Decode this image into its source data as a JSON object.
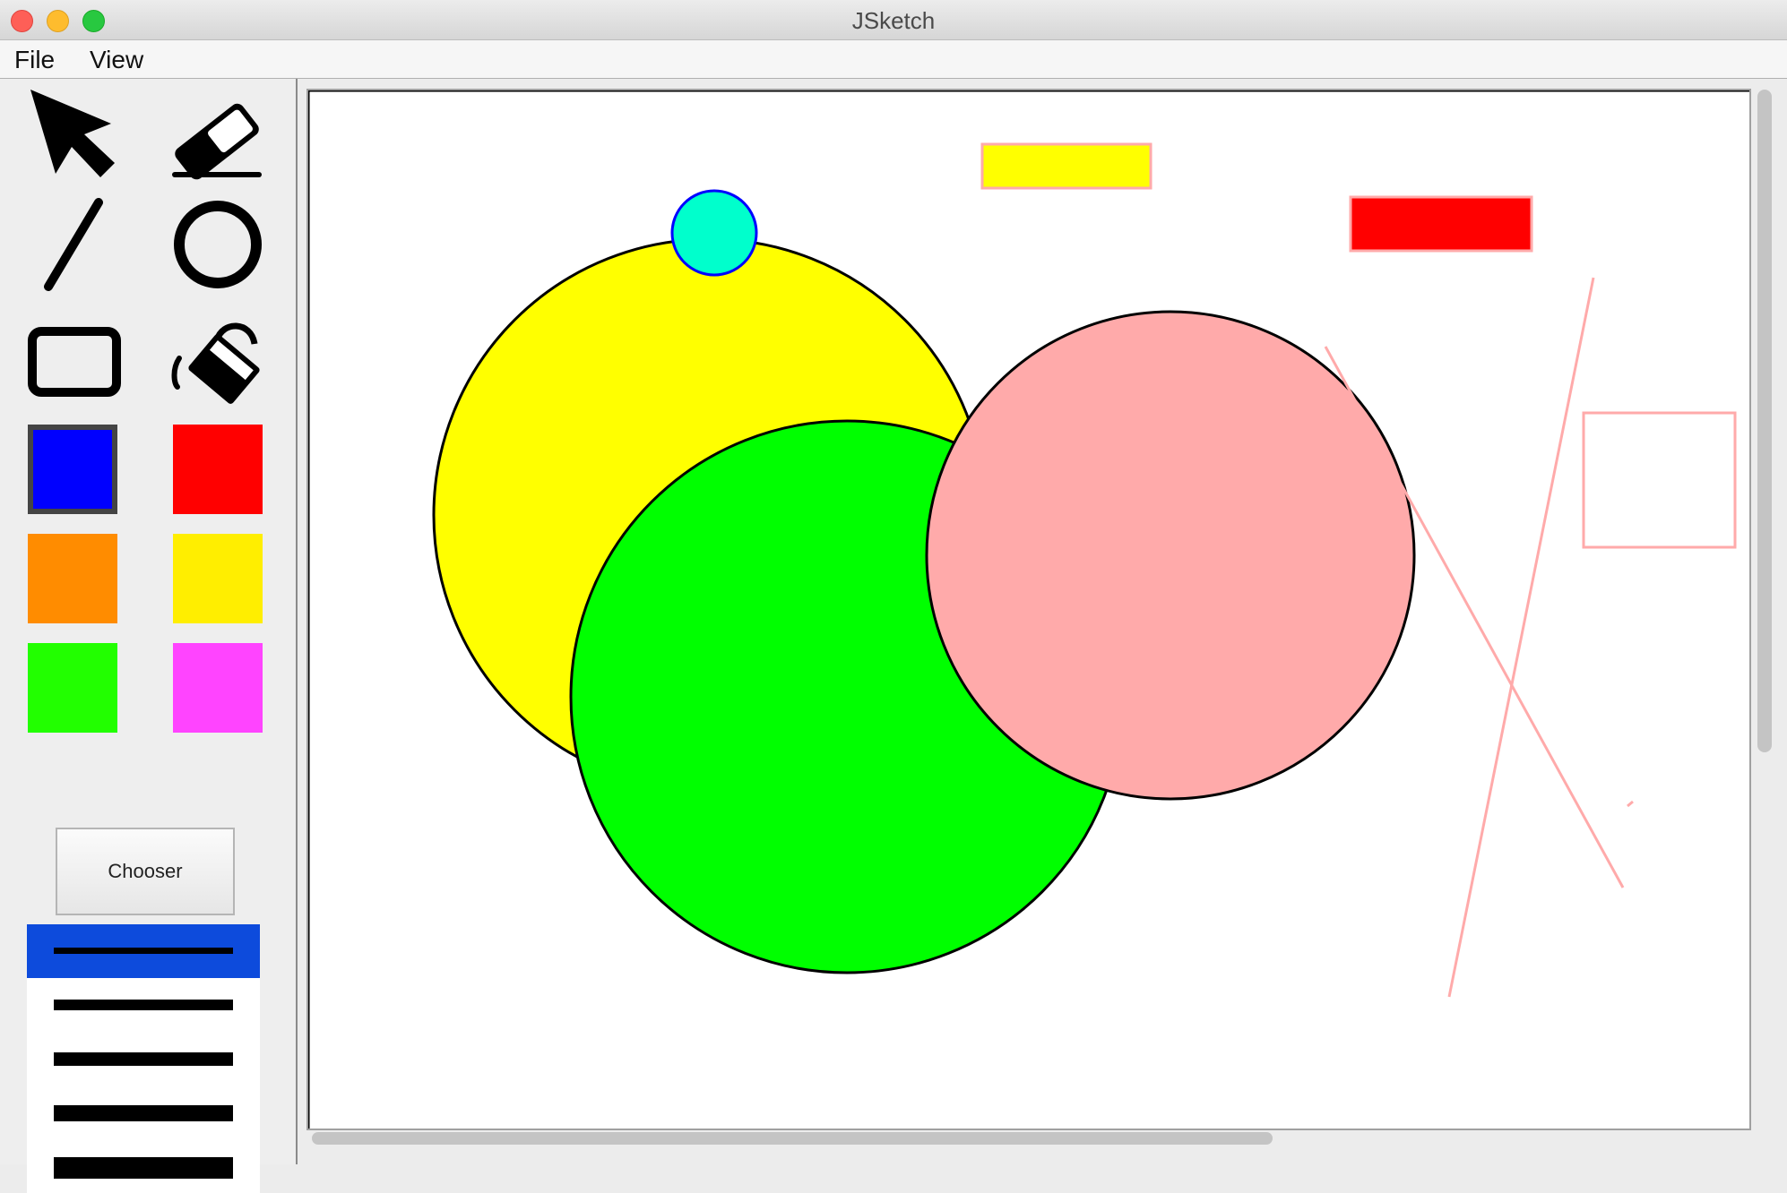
{
  "window": {
    "title": "JSketch"
  },
  "menu": {
    "file": "File",
    "view": "View"
  },
  "tools": [
    "select-icon",
    "eraser-icon",
    "line-icon",
    "circle-icon",
    "rectangle-icon",
    "fill-bucket-icon"
  ],
  "palette": [
    {
      "name": "blue",
      "color": "#0000ff",
      "selected": true
    },
    {
      "name": "red",
      "color": "#ff0000",
      "selected": false
    },
    {
      "name": "orange",
      "color": "#ff8c00",
      "selected": false
    },
    {
      "name": "yellow",
      "color": "#ffee00",
      "selected": false
    },
    {
      "name": "green",
      "color": "#22ff00",
      "selected": false
    },
    {
      "name": "magenta",
      "color": "#ff44ff",
      "selected": false
    }
  ],
  "chooser": {
    "label": "Chooser"
  },
  "line_weights": {
    "count": 5,
    "selected_index": 0,
    "selected_bg": "#0d4bdc"
  },
  "canvas": {
    "background": "#ffffff",
    "shapes": [
      {
        "type": "circle",
        "fill": "#ffff00",
        "stroke": "#000000"
      },
      {
        "type": "circle",
        "fill": "#00ff00",
        "stroke": "#000000"
      },
      {
        "type": "circle",
        "fill": "#ffaaaa",
        "stroke": "#000000"
      },
      {
        "type": "circle",
        "fill": "#00ffcc",
        "stroke": "#0000ff"
      },
      {
        "type": "rectangle",
        "fill": "#ffff00",
        "stroke": "#ffaaaa"
      },
      {
        "type": "rectangle",
        "fill": "#ff0000",
        "stroke": "#ffaaaa"
      },
      {
        "type": "rectangle",
        "fill": "none",
        "stroke": "#ffaaaa"
      },
      {
        "type": "line",
        "stroke": "#ffaaaa"
      },
      {
        "type": "line",
        "stroke": "#ffaaaa"
      },
      {
        "type": "line",
        "stroke": "#ffaaaa"
      }
    ]
  }
}
